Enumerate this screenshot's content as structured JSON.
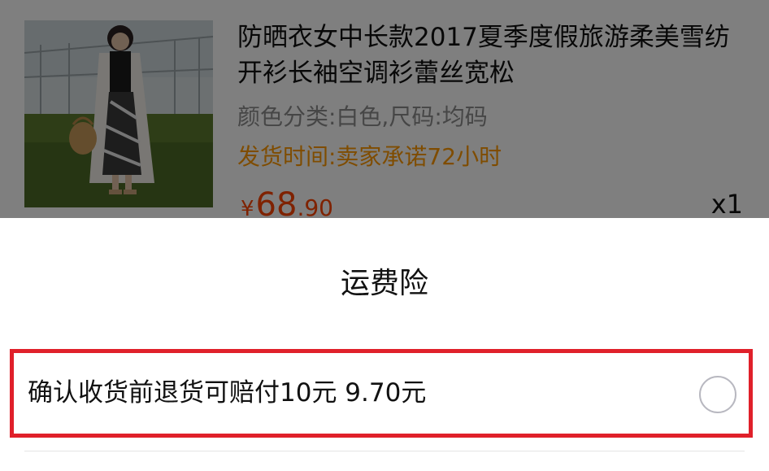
{
  "product": {
    "title": "防晒衣女中长款2017夏季度假旅游柔美雪纺开衫长袖空调衫蕾丝宽松",
    "spec": "颜色分类:白色,尺码:均码",
    "shipping": "发货时间:卖家承诺72小时",
    "price_currency": "¥",
    "price_integer": "68",
    "price_decimal": ".90",
    "quantity": "x1",
    "colors": {
      "price": "#ff4400",
      "shipping": "#ff9900"
    }
  },
  "sheet": {
    "title": "运费险",
    "option": {
      "label": "确认收货前退货可赔付10元 9.70元",
      "selected": false
    },
    "highlight_color": "#e0202a"
  }
}
